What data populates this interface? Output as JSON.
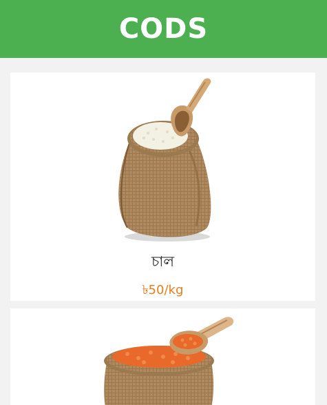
{
  "header": {
    "title": "CODS"
  },
  "colors": {
    "header_bg": "#4caf50",
    "page_bg": "#f2f2f2",
    "price_text": "#e67e22"
  },
  "products": [
    {
      "name": "চাল",
      "price": "৳50/kg",
      "image_icon": "rice-sack-image"
    },
    {
      "image_icon": "lentil-sack-image"
    }
  ]
}
